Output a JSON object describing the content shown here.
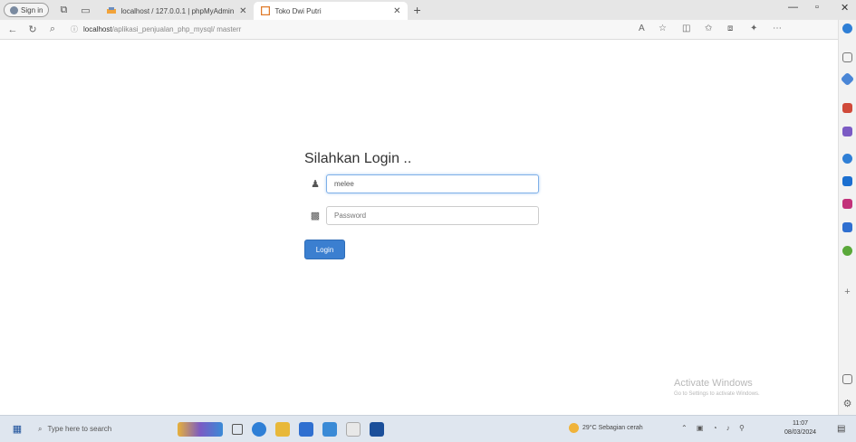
{
  "browser": {
    "signin_label": "Sign in",
    "tabs": [
      {
        "title": "localhost / 127.0.0.1 | phpMyAdmin",
        "active": false
      },
      {
        "title": "Toko Dwi Putri",
        "active": true
      }
    ],
    "address": {
      "host": "localhost",
      "path": "/aplikasi_penjualan_php_mysql/ masterr"
    }
  },
  "login": {
    "title": "Silahkan Login ..",
    "username_value": "melee",
    "password_placeholder": "Password",
    "button_label": "Login"
  },
  "watermark": {
    "line1": "Activate Windows",
    "line2": "Go to Settings to activate Windows."
  },
  "taskbar": {
    "search_placeholder": "Type here to search",
    "weather": "29°C  Sebagian cerah",
    "time": "11:07",
    "date": "08/03/2024"
  },
  "colors": {
    "login_button": "#3b7fd0",
    "taskbar_bg": "#dfe6ef"
  }
}
